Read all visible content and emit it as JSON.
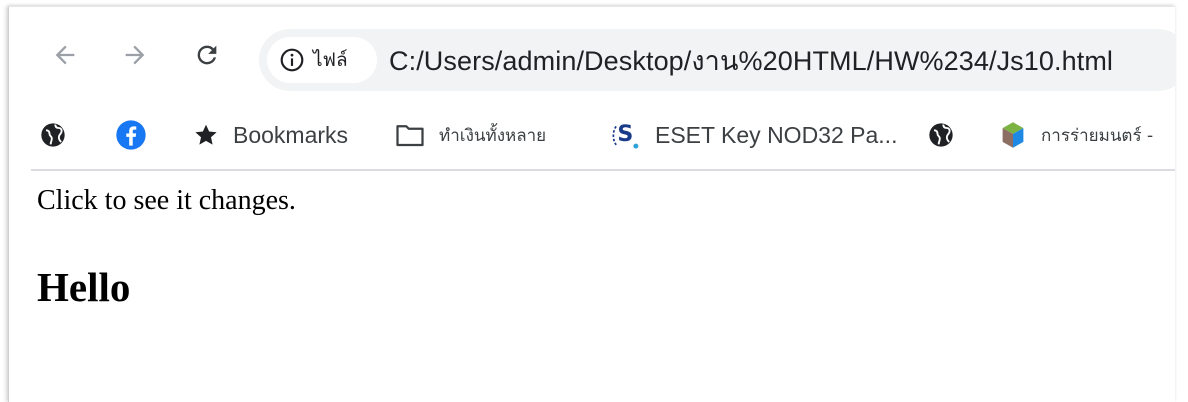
{
  "toolbar": {
    "back_icon": "arrow-left-icon",
    "forward_icon": "arrow-right-icon",
    "reload_icon": "reload-icon",
    "site_info_label": "ไฟล์",
    "address": "C:/Users/admin/Desktop/งาน%20HTML/HW%234/Js10.html"
  },
  "bookmarks": [
    {
      "icon": "globe-icon",
      "label": ""
    },
    {
      "icon": "facebook-icon",
      "label": ""
    },
    {
      "icon": "star-icon",
      "label": "Bookmarks"
    },
    {
      "icon": "folder-icon",
      "label": "ทำเงินทั้งหลาย"
    },
    {
      "icon": "eset-icon",
      "label": "ESET Key NOD32 Pa..."
    },
    {
      "icon": "globe-icon",
      "label": ""
    },
    {
      "icon": "cube-icon",
      "label": "การร่ายมนตร์ -"
    }
  ],
  "page": {
    "paragraph": "Click to see it changes.",
    "heading": "Hello"
  },
  "colors": {
    "omnibox_bg": "#f1f3f4",
    "facebook_blue": "#1877f2",
    "icon_gray": "#5f6368"
  }
}
